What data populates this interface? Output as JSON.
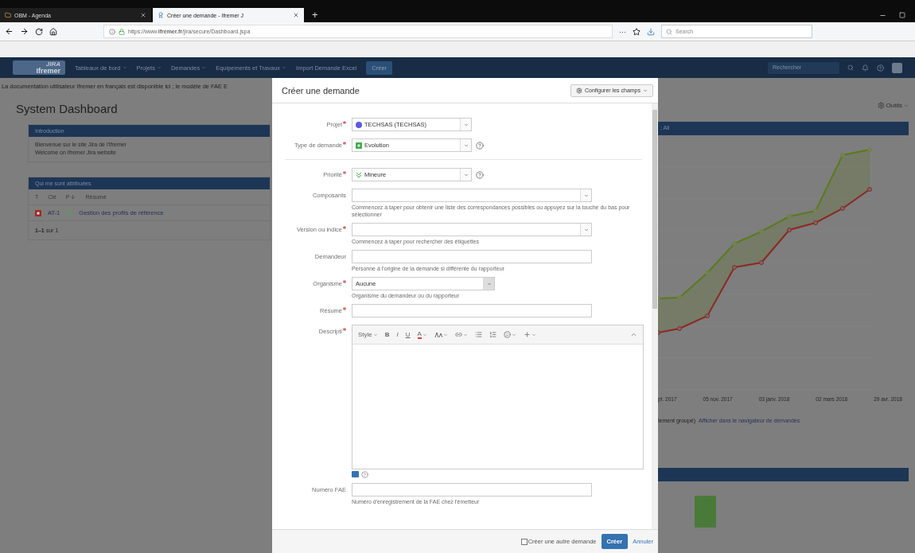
{
  "browser": {
    "tabs": [
      {
        "title": "OBM - Agenda",
        "selected": false
      },
      {
        "title": "Créer une demande - Ifremer J",
        "selected": true
      }
    ],
    "new_tab": "+",
    "url": "https://www.**ifremer.fr**/jira/secure/Dashboard.jspa",
    "more": "···",
    "search_placeholder": "Search"
  },
  "jira_nav": {
    "logo": "JIRA",
    "logo_sub": "Ifremer",
    "menus": [
      {
        "label": "Tableaux de bord",
        "dropdown": true
      },
      {
        "label": "Projets",
        "dropdown": true
      },
      {
        "label": "Demandes",
        "dropdown": true
      },
      {
        "label": "Equipements et Travaux",
        "dropdown": true
      },
      {
        "label": "Import Demande Excel",
        "dropdown": false
      }
    ],
    "create": "Créer",
    "search_placeholder": "Rechercher"
  },
  "banner": "La documentation utilisateur Ifremer en français est disponible ici ; le modèle de FAE E",
  "dashboard": {
    "title": "System Dashboard",
    "tools": "Outils",
    "intro": {
      "header": "Introduction",
      "lines": [
        "Bienvenue sur le site Jira de l'Ifremer",
        "Welcome on Ifremer Jira website"
      ]
    },
    "assigned": {
      "header": "Qui me sont attribuées",
      "columns": [
        {
          "label": "T",
          "sorted": false
        },
        {
          "label": "Clé",
          "sorted": false
        },
        {
          "label": "P",
          "sorted": true
        },
        {
          "label": "Résumé",
          "sorted": false
        }
      ],
      "rows": [
        {
          "key": "AT-1",
          "summary": "Gestion des profils de référence"
        }
      ],
      "count": "**1–1** sur 1"
    },
    "chart_panel": {
      "header": ": All",
      "x_labels": [
        "pt. 2017",
        "05 nov. 2017",
        "03 janv. 2018",
        "02 mars 2018",
        "29 avr. 2018"
      ],
      "footer_text": "lement groupé)",
      "link": "Afficher dans le navigateur de demandes"
    }
  },
  "dialog": {
    "title": "Créer une demande",
    "configure": "Configurer les champs",
    "fields": [
      {
        "kind": "project",
        "label": "Projet",
        "required": true,
        "value": "TECHSAS (TECHSAS)",
        "help": false
      },
      {
        "kind": "issuetype",
        "label": "Type de demande",
        "required": true,
        "value": "Evolution",
        "help": true
      },
      {
        "kind": "divider"
      },
      {
        "kind": "priority",
        "label": "Priorité",
        "required": true,
        "value": "Mineure",
        "help": true
      },
      {
        "kind": "picker",
        "label": "Composants",
        "required": false,
        "hint": "Commencez à taper pour obtenir une liste des correspondances possibles ou appuyez sur la touche du bas pour sélectionner"
      },
      {
        "kind": "picker",
        "label": "Version ou indice",
        "required": true,
        "hint": "Commencez à taper pour rechercher des étiquettes"
      },
      {
        "kind": "text",
        "label": "Demandeur",
        "required": false,
        "hint": "Personne à l'origine de la demande si différente du rapporteur"
      },
      {
        "kind": "native",
        "label": "Organisme",
        "required": true,
        "value": "Aucune",
        "hint": "Organisme du demandeur ou du rapporteur"
      },
      {
        "kind": "text",
        "label": "Résumé",
        "required": true
      },
      {
        "kind": "editor",
        "label": "Descripti",
        "required": true
      },
      {
        "kind": "text",
        "label": "Numéro FAE",
        "required": false,
        "hint": "Numéro d'enregistrement de la FAE chez l'émetteur"
      }
    ],
    "toolbar": [
      {
        "kind": "style",
        "label": "Style",
        "dropdown": true
      },
      {
        "kind": "bold",
        "label": "B"
      },
      {
        "kind": "italic",
        "label": "I"
      },
      {
        "kind": "underline",
        "label": "U"
      },
      {
        "kind": "color",
        "label": "A",
        "dropdown": true
      },
      {
        "kind": "size",
        "dropdown": true
      },
      {
        "kind": "link",
        "dropdown": true
      },
      {
        "kind": "bullets"
      },
      {
        "kind": "numbers"
      },
      {
        "kind": "emoji",
        "dropdown": true
      },
      {
        "kind": "plus",
        "dropdown": true
      },
      {
        "kind": "collapse"
      }
    ],
    "another": {
      "label": "Créer une autre demande",
      "checked": false
    },
    "submit": "Créer",
    "cancel": "Annuler"
  }
}
